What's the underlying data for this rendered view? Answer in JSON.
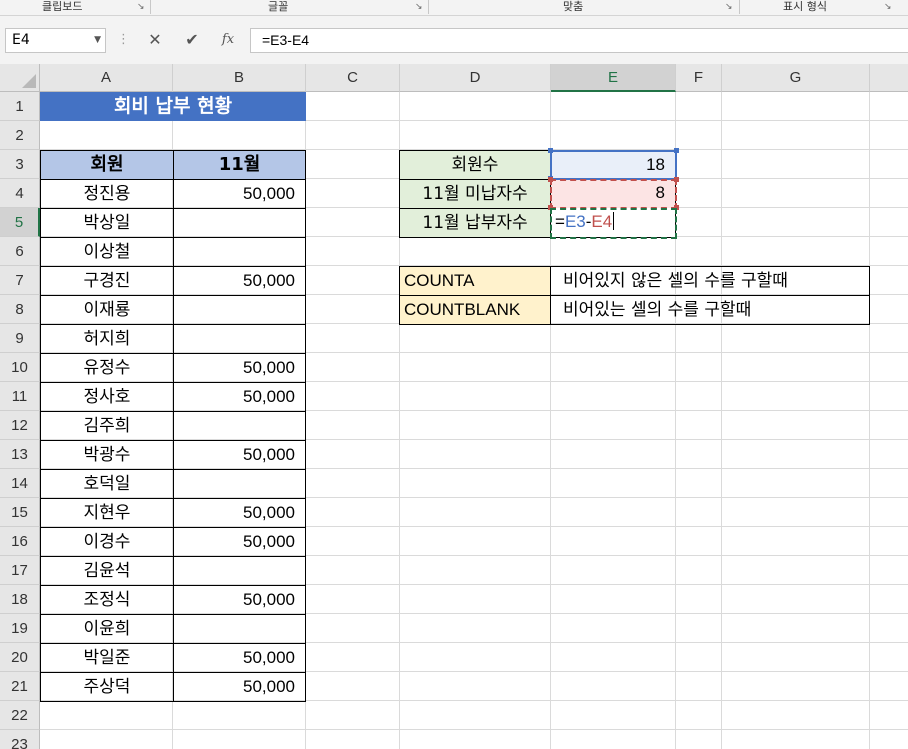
{
  "ribbon": {
    "groups": [
      "클립보드",
      "글꼴",
      "맞춤",
      "표시 형식"
    ]
  },
  "formula_bar": {
    "name_box": "E4",
    "formula": "=E3-E4",
    "cancel_icon": "✕",
    "enter_icon": "✔",
    "fx_label": "fx"
  },
  "columns": [
    "A",
    "B",
    "C",
    "D",
    "E",
    "F",
    "G"
  ],
  "rows": [
    "1",
    "2",
    "3",
    "4",
    "5",
    "6",
    "7",
    "8",
    "9",
    "10",
    "11",
    "12",
    "13",
    "14",
    "15",
    "16",
    "17",
    "18",
    "19",
    "20",
    "21",
    "22",
    "23"
  ],
  "sheet": {
    "title": "회비 납부 현황",
    "header_member": "회원",
    "header_month": "11월",
    "members": [
      {
        "name": "정진용",
        "amount": "50,000"
      },
      {
        "name": "박상일",
        "amount": ""
      },
      {
        "name": "이상철",
        "amount": ""
      },
      {
        "name": "구경진",
        "amount": "50,000"
      },
      {
        "name": "이재룡",
        "amount": ""
      },
      {
        "name": "허지희",
        "amount": ""
      },
      {
        "name": "유정수",
        "amount": "50,000"
      },
      {
        "name": "정사호",
        "amount": "50,000"
      },
      {
        "name": "김주희",
        "amount": ""
      },
      {
        "name": "박광수",
        "amount": "50,000"
      },
      {
        "name": "호덕일",
        "amount": ""
      },
      {
        "name": "지현우",
        "amount": "50,000"
      },
      {
        "name": "이경수",
        "amount": "50,000"
      },
      {
        "name": "김윤석",
        "amount": ""
      },
      {
        "name": "조정식",
        "amount": "50,000"
      },
      {
        "name": "이윤희",
        "amount": ""
      },
      {
        "name": "박일준",
        "amount": "50,000"
      },
      {
        "name": "주상덕",
        "amount": "50,000"
      }
    ],
    "summary": [
      {
        "label": "회원수",
        "value": "18"
      },
      {
        "label": "11월 미납자수",
        "value": "8"
      },
      {
        "label": "11월 납부자수",
        "value": ""
      }
    ],
    "editing": {
      "eq": "=",
      "ref1": "E3",
      "op": "-",
      "ref2": "E4"
    },
    "functions": [
      {
        "name": "COUNTA",
        "desc": "비어있지 않은 셀의 수를 구할때"
      },
      {
        "name": "COUNTBLANK",
        "desc": "비어있는 셀의 수를 구할때"
      }
    ]
  },
  "colors": {
    "accent": "#217346",
    "title_bg": "#4472c4",
    "header_bg": "#b4c6e7",
    "summary_label_bg": "#e2efda",
    "ref_blue": "#4472c4",
    "ref_red": "#c0504d",
    "func_bg": "#fff2cc"
  }
}
